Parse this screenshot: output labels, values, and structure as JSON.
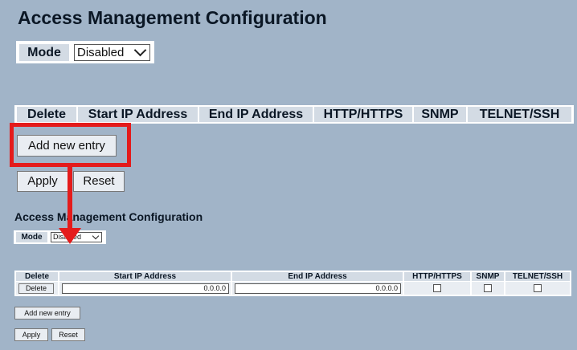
{
  "zoomed": {
    "title": "Access Management Configuration",
    "mode_label": "Mode",
    "mode_value": "Disabled",
    "columns": [
      "Delete",
      "Start IP Address",
      "End IP Address",
      "HTTP/HTTPS",
      "SNMP",
      "TELNET/SSH"
    ],
    "add_entry_label": "Add new entry",
    "apply_label": "Apply",
    "reset_label": "Reset"
  },
  "actual": {
    "title": "Access Management Configuration",
    "mode_label": "Mode",
    "mode_value": "Disabled",
    "columns": [
      "Delete",
      "Start IP Address",
      "End IP Address",
      "HTTP/HTTPS",
      "SNMP",
      "TELNET/SSH"
    ],
    "row": {
      "delete_label": "Delete",
      "start_ip": "0.0.0.0",
      "end_ip": "0.0.0.0",
      "http_https": false,
      "snmp": false,
      "telnet_ssh": false
    },
    "add_entry_label": "Add new entry",
    "apply_label": "Apply",
    "reset_label": "Reset"
  },
  "annotation": {
    "color": "#e41b1b"
  }
}
